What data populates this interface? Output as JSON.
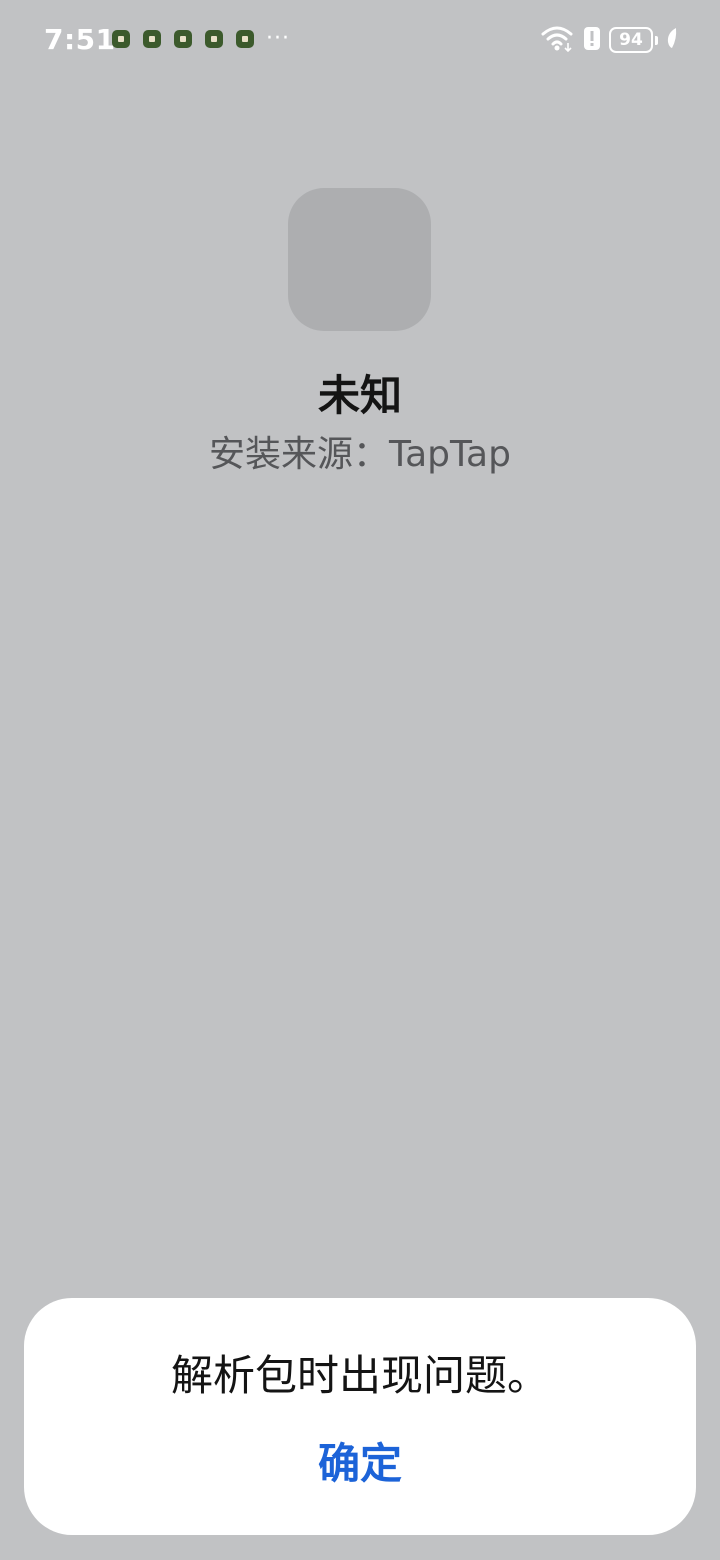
{
  "status_bar": {
    "time": "7:51",
    "notification_icons": [
      "app-notification-icon",
      "app-notification-icon",
      "app-notification-icon",
      "app-notification-icon",
      "app-notification-icon"
    ],
    "more_indicator": "···",
    "battery_level": "94",
    "icons": [
      "wifi-icon",
      "battery-alert-icon",
      "battery-icon",
      "leaf-icon"
    ]
  },
  "app": {
    "name": "未知",
    "install_source": "安装来源：TapTap"
  },
  "dialog": {
    "message": "解析包时出现问题。",
    "confirm_label": "确定"
  },
  "colors": {
    "background": "#c1c2c4",
    "accent": "#1c63d8",
    "dialog_background": "#ffffff"
  }
}
